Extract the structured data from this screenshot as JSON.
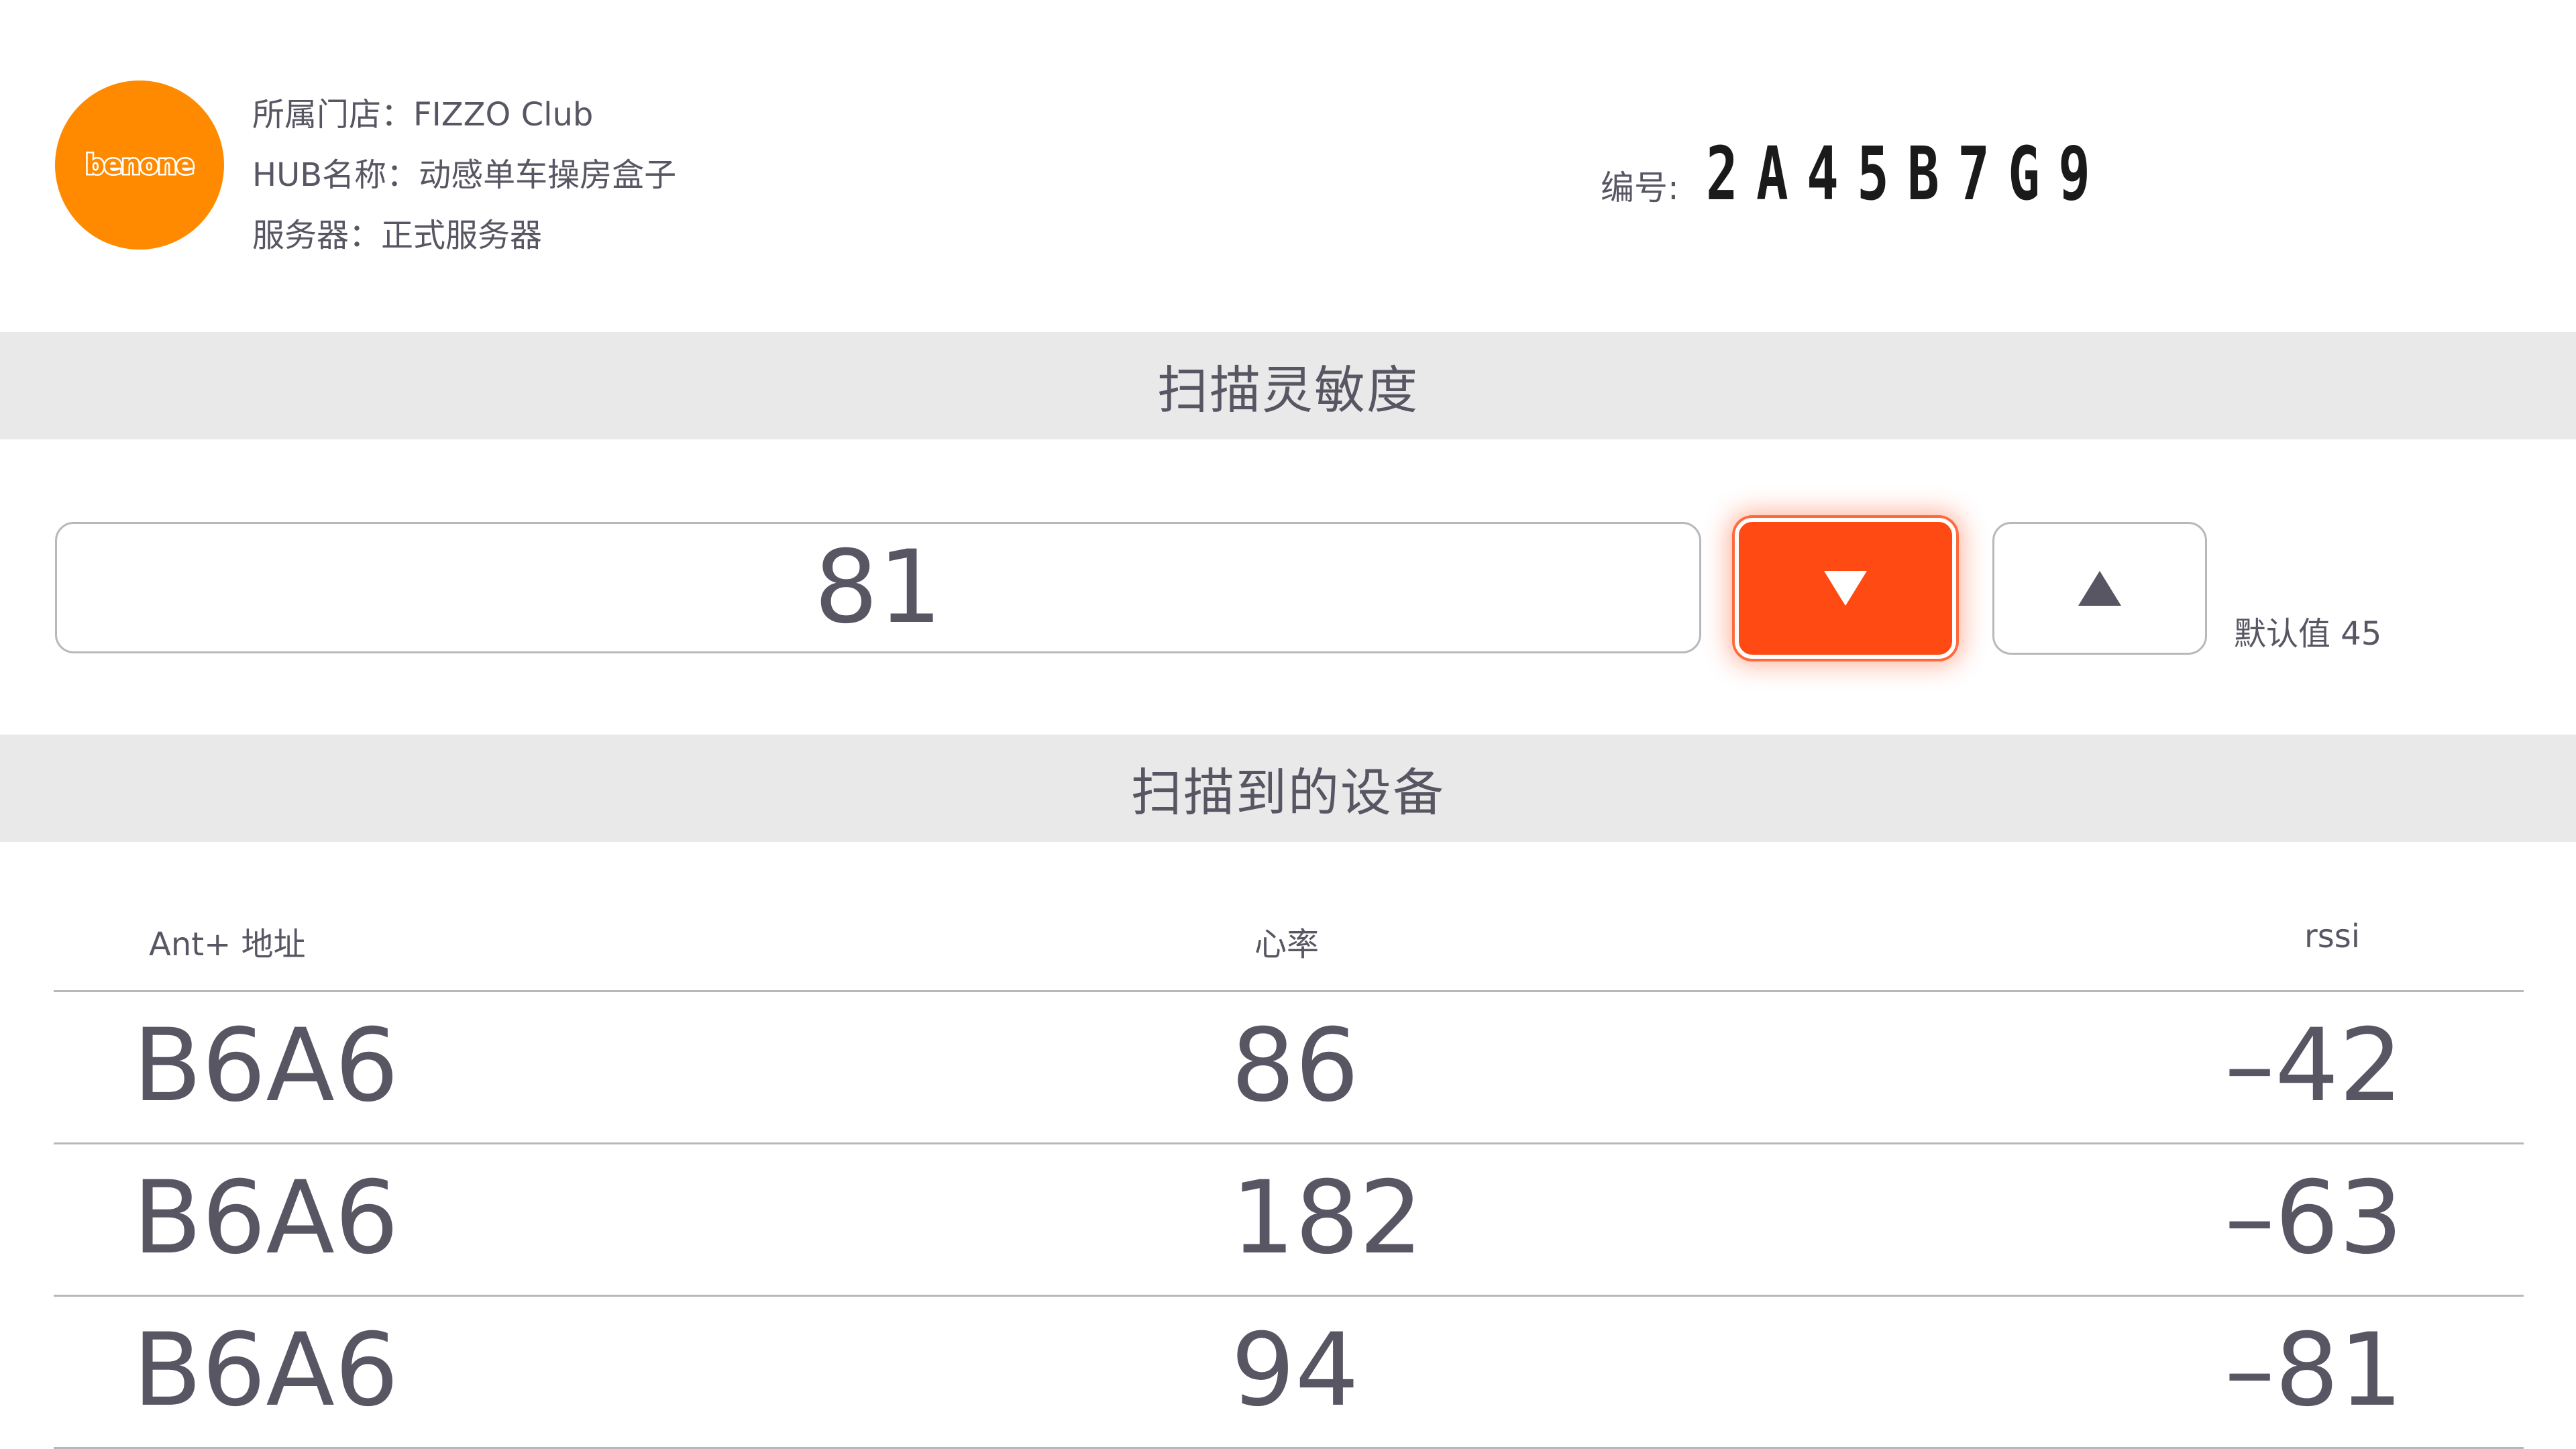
{
  "header": {
    "logo_text": "benone",
    "store_label": "所属门店：",
    "store_value": "FIZZO Club",
    "hub_label": "HUB名称：",
    "hub_value": "动感单车操房盒子",
    "server_label": "服务器：",
    "server_value": "正式服务器",
    "serial_label": "编号:",
    "serial_value": "2A45B7G9"
  },
  "sensitivity": {
    "title": "扫描灵敏度",
    "value": "81",
    "down_icon": "triangle-down-icon",
    "up_icon": "triangle-up-icon",
    "default_note": "默认值 45",
    "accent_color": "#ff4a14"
  },
  "devices": {
    "title": "扫描到的设备",
    "columns": [
      "Ant+ 地址",
      "心率",
      "rssi"
    ],
    "rows": [
      {
        "ant": "B6A6",
        "hr": "86",
        "rssi": "–42"
      },
      {
        "ant": "B6A6",
        "hr": "182",
        "rssi": "–63"
      },
      {
        "ant": "B6A6",
        "hr": "94",
        "rssi": "–81"
      }
    ]
  },
  "colors": {
    "logo": "#ff8a00",
    "section_bar": "#e9e9e9",
    "text": "#585663"
  }
}
